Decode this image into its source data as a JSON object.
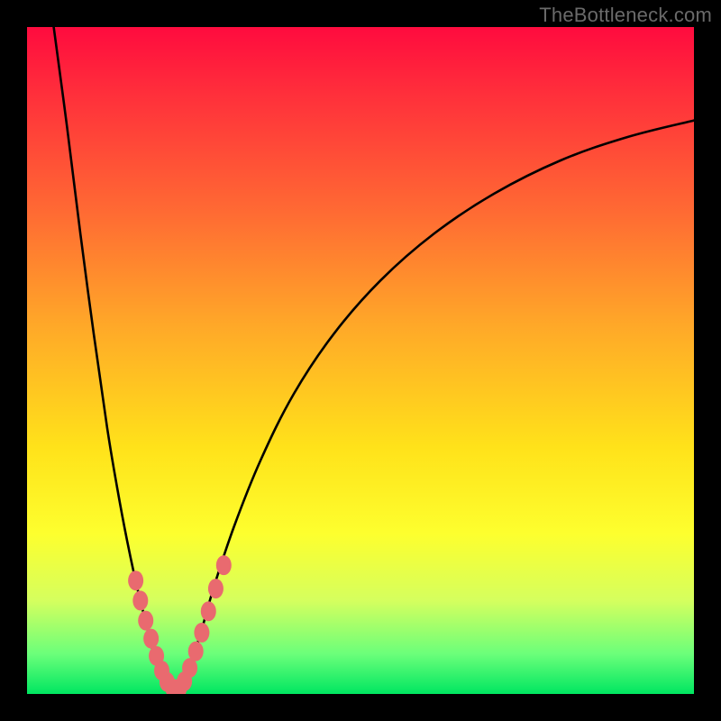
{
  "watermark": "TheBottleneck.com",
  "colors": {
    "frame": "#000000",
    "curve": "#000000",
    "marker_fill": "#e96a6f",
    "marker_stroke": "#d24e54",
    "gradient_top": "#ff0b3e",
    "gradient_bottom": "#00e661"
  },
  "chart_data": {
    "type": "line",
    "title": "",
    "xlabel": "",
    "ylabel": "",
    "xlim": [
      0,
      100
    ],
    "ylim": [
      0,
      100
    ],
    "grid": false,
    "legend": false,
    "series": [
      {
        "name": "left-branch",
        "x": [
          4,
          6,
          8,
          10,
          12,
          13.5,
          15,
          16.5,
          18,
          19,
          20,
          21,
          22
        ],
        "y": [
          100,
          85,
          69,
          54,
          40,
          31,
          23,
          16,
          10,
          6,
          3,
          1,
          0
        ]
      },
      {
        "name": "right-branch",
        "x": [
          22,
          23,
          24,
          26,
          28,
          31,
          35,
          40,
          46,
          53,
          61,
          70,
          80,
          90,
          100
        ],
        "y": [
          0,
          1,
          3,
          9,
          16,
          25,
          35,
          45,
          54,
          62,
          69,
          75,
          80,
          83.5,
          86
        ]
      }
    ],
    "markers": [
      {
        "x": 16.3,
        "y": 17
      },
      {
        "x": 17.0,
        "y": 14
      },
      {
        "x": 17.8,
        "y": 11
      },
      {
        "x": 18.6,
        "y": 8.3
      },
      {
        "x": 19.4,
        "y": 5.7
      },
      {
        "x": 20.2,
        "y": 3.5
      },
      {
        "x": 21.0,
        "y": 1.8
      },
      {
        "x": 21.9,
        "y": 0.8
      },
      {
        "x": 22.8,
        "y": 0.8
      },
      {
        "x": 23.6,
        "y": 1.9
      },
      {
        "x": 24.4,
        "y": 3.9
      },
      {
        "x": 25.3,
        "y": 6.4
      },
      {
        "x": 26.2,
        "y": 9.2
      },
      {
        "x": 27.2,
        "y": 12.4
      },
      {
        "x": 28.3,
        "y": 15.8
      },
      {
        "x": 29.5,
        "y": 19.3
      }
    ]
  }
}
